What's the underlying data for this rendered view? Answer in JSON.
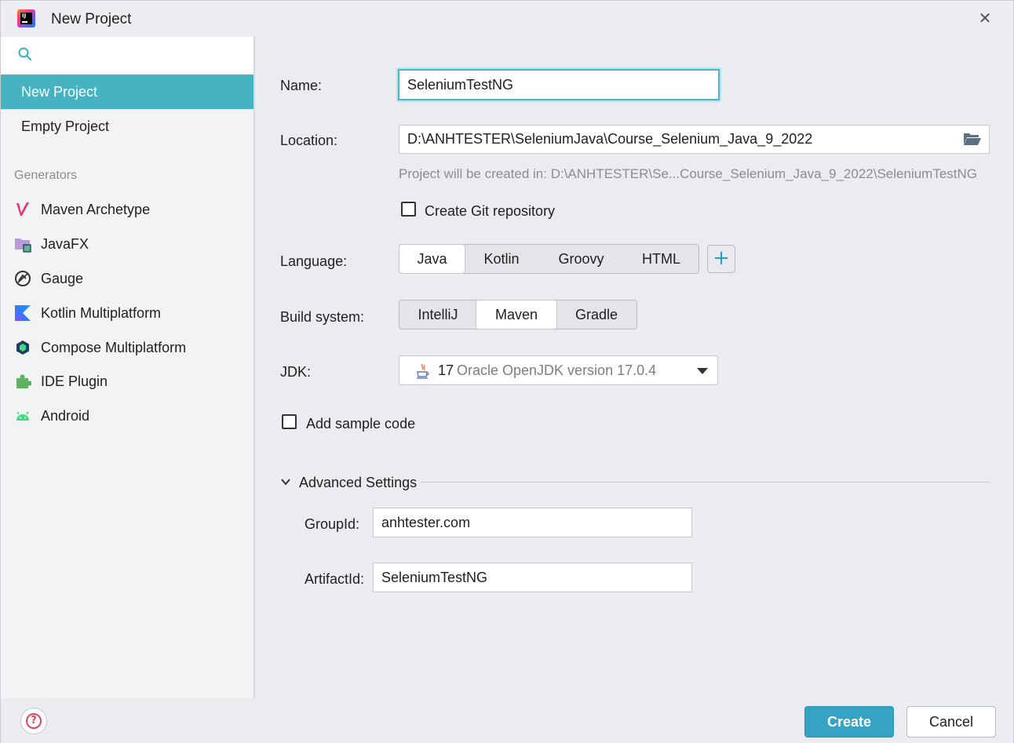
{
  "window": {
    "title": "New Project",
    "close_glyph": "✕"
  },
  "sidebar": {
    "search_placeholder": "",
    "project_types": [
      {
        "label": "New Project",
        "selected": true
      },
      {
        "label": "Empty Project",
        "selected": false
      }
    ],
    "generators_heading": "Generators",
    "generators": [
      {
        "label": "Maven Archetype",
        "icon": "maven-icon"
      },
      {
        "label": "JavaFX",
        "icon": "javafx-icon"
      },
      {
        "label": "Gauge",
        "icon": "gauge-icon"
      },
      {
        "label": "Kotlin Multiplatform",
        "icon": "kotlin-icon"
      },
      {
        "label": "Compose Multiplatform",
        "icon": "compose-icon"
      },
      {
        "label": "IDE Plugin",
        "icon": "plugin-icon"
      },
      {
        "label": "Android",
        "icon": "android-icon"
      }
    ]
  },
  "form": {
    "name_label": "Name:",
    "name_value": "SeleniumTestNG",
    "location_label": "Location:",
    "location_value": "D:\\ANHTESTER\\SeleniumJava\\Course_Selenium_Java_9_2022",
    "location_hint": "Project will be created in: D:\\ANHTESTER\\Se...Course_Selenium_Java_9_2022\\SeleniumTestNG",
    "git_label": "Create Git repository",
    "git_checked": false,
    "language_label": "Language:",
    "languages": [
      "Java",
      "Kotlin",
      "Groovy",
      "HTML"
    ],
    "language_selected": "Java",
    "add_language_glyph": "+",
    "build_label": "Build system:",
    "build_systems": [
      "IntelliJ",
      "Maven",
      "Gradle"
    ],
    "build_selected": "Maven",
    "jdk_label": "JDK:",
    "jdk_version": "17",
    "jdk_desc": "Oracle OpenJDK version 17.0.4",
    "sample_code_label": "Add sample code",
    "sample_code_checked": false
  },
  "advanced": {
    "title": "Advanced Settings",
    "expanded": true,
    "group_label": "GroupId:",
    "group_value": "anhtester.com",
    "artifact_label": "ArtifactId:",
    "artifact_value": "SeleniumTestNG"
  },
  "footer": {
    "help_glyph": "?",
    "create_label": "Create",
    "cancel_label": "Cancel"
  },
  "colors": {
    "accent": "#45b3c2",
    "primary_button": "#34a3c4",
    "help": "#e0455b"
  }
}
